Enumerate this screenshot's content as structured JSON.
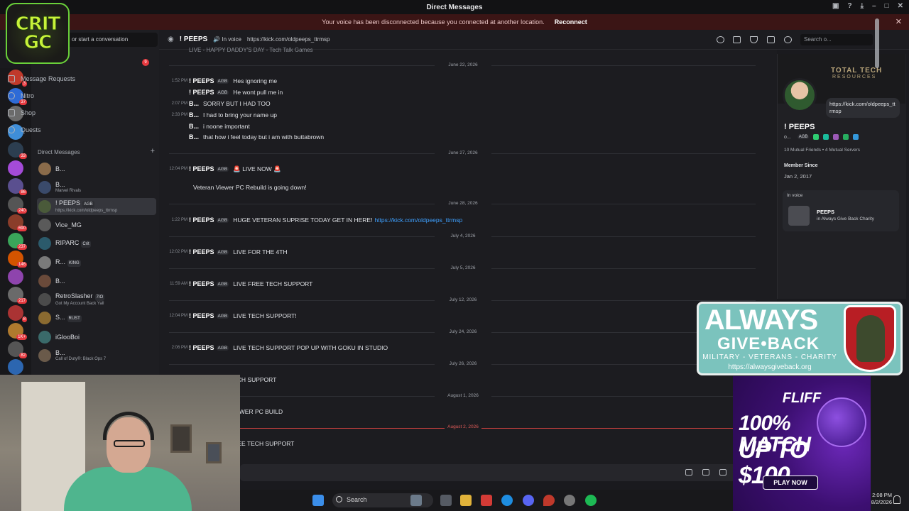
{
  "window": {
    "title": "Direct Messages"
  },
  "banner": {
    "message": "Your voice has been disconnected because you connected at another location.",
    "action": "Reconnect"
  },
  "overlay_logo": {
    "line1": "CRIT",
    "line2": "GC"
  },
  "top_search": {
    "placeholder": "or start a conversation"
  },
  "sidebar": {
    "nav": [
      {
        "label": "Message Requests"
      },
      {
        "label": "Nitro"
      },
      {
        "label": "Shop"
      },
      {
        "label": "Quests"
      }
    ],
    "dm_header": "Direct Messages",
    "dm_add": "+",
    "unread_badge": "9",
    "dms": [
      {
        "name": "B...",
        "sub": "",
        "tag": ""
      },
      {
        "name": "B...",
        "sub": "Marvel Rivals",
        "tag": ""
      },
      {
        "name": "! PEEPS",
        "sub": "https://kick.com/oldpeeps_ttrmsp",
        "tag": "AGB"
      },
      {
        "name": "Vice_MG",
        "sub": "",
        "tag": ""
      },
      {
        "name": "RIPARC",
        "sub": "",
        "tag": "Crit"
      },
      {
        "name": "R...",
        "sub": "",
        "tag": "KING"
      },
      {
        "name": "B...",
        "sub": "",
        "tag": ""
      },
      {
        "name": "RetroSlasher",
        "sub": "Got My Account Back Yall",
        "tag": "7IO"
      },
      {
        "name": "S...",
        "sub": "",
        "tag": "RUST"
      },
      {
        "name": "iGlooBoi",
        "sub": "",
        "tag": ""
      },
      {
        "name": "B...",
        "sub": "Call of Duty®: Black Ops 7",
        "tag": ""
      }
    ]
  },
  "server_badges": [
    "3",
    "37",
    "",
    "",
    "33",
    "",
    "86",
    "240",
    "690",
    "237",
    "146",
    "",
    "217",
    "8",
    "1K+",
    "82",
    ""
  ],
  "chat_header": {
    "title": "! PEEPS",
    "status": "In voice",
    "link": "https://kick.com/oldpeeps_ttrmsp",
    "search_placeholder": "Search o..."
  },
  "messages": {
    "top_clip": "LIVE - HAPPY DADDY'S DAY - Tech Talk Games",
    "groups": [
      {
        "date": "June 22, 2026",
        "items": [
          {
            "time": "1:52 PM",
            "author": "! PEEPS",
            "tag": "AGB",
            "text": "Hes ignoring me",
            "link": ""
          },
          {
            "time": "",
            "author": "! PEEPS",
            "tag": "AGB",
            "text": "He wont pull me in",
            "link": ""
          },
          {
            "time": "2:07 PM",
            "author": "B...",
            "tag": "",
            "text": "SORRY BUT I HAD TOO",
            "link": ""
          },
          {
            "time": "2:33 PM",
            "author": "B...",
            "tag": "",
            "text": "I had to bring your name up",
            "link": ""
          },
          {
            "time": "",
            "author": "B...",
            "tag": "",
            "text": "i noone important",
            "link": ""
          },
          {
            "time": "",
            "author": "B...",
            "tag": "",
            "text": "that how i feel today but i am with buttabrown",
            "link": ""
          }
        ]
      },
      {
        "date": "June 27, 2026",
        "items": [
          {
            "time": "12:04 PM",
            "author": "! PEEPS",
            "tag": "AGB",
            "text": "🚨 LIVE NOW 🚨",
            "link": ""
          },
          {
            "time": "",
            "author": "",
            "tag": "",
            "text": "Veteran Viewer PC Rebuild is going down!",
            "link": ""
          }
        ]
      },
      {
        "date": "June 28, 2026",
        "items": [
          {
            "time": "1:22 PM",
            "author": "! PEEPS",
            "tag": "AGB",
            "text": "HUGE VETERAN SUPRISE TODAY GET IN HERE!",
            "link": "https://kick.com/oldpeeps_ttrmsp"
          }
        ]
      },
      {
        "date": "July 4, 2026",
        "items": [
          {
            "time": "12:02 PM",
            "author": "! PEEPS",
            "tag": "AGB",
            "text": "LIVE FOR THE 4TH",
            "link": ""
          }
        ]
      },
      {
        "date": "July 5, 2026",
        "items": [
          {
            "time": "11:59 AM",
            "author": "! PEEPS",
            "tag": "AGB",
            "text": "LIVE FREE TECH SUPPORT",
            "link": ""
          }
        ]
      },
      {
        "date": "July 12, 2026",
        "items": [
          {
            "time": "12:04 PM",
            "author": "! PEEPS",
            "tag": "AGB",
            "text": "LIVE TECH SUPPORT!",
            "link": ""
          }
        ]
      },
      {
        "date": "July 24, 2026",
        "items": [
          {
            "time": "2:06 PM",
            "author": "! PEEPS",
            "tag": "AGB",
            "text": "LIVE TECH SUPPORT POP UP WITH GOKU IN STUDIO",
            "link": ""
          }
        ]
      },
      {
        "date": "July 26, 2026",
        "items": [
          {
            "time": "",
            "author": "",
            "tag": "",
            "text": "IVE TECH SUPPORT",
            "link": ""
          }
        ]
      },
      {
        "date": "August 1, 2026",
        "items": [
          {
            "time": "",
            "author": "",
            "tag": "",
            "text": "IVE VIEWER PC BUILD",
            "link": ""
          }
        ]
      },
      {
        "date": "August 2, 2026",
        "items": [
          {
            "time": "",
            "author": "",
            "tag": "",
            "text": "IVE FREE TECH SUPPORT",
            "link": ""
          }
        ]
      }
    ]
  },
  "profile": {
    "banner_brand": "TOTAL TECH",
    "banner_brand_sub": "RESOURCES",
    "bio": "https://kick.com/oldpeeps_ttrmsp",
    "name": "! PEEPS",
    "handle": "o...",
    "tag": "AGB",
    "mutual": "10 Mutual Friends  •  4 Mutual Servers",
    "member_since_label": "Member Since",
    "member_since": "Jan 2, 2017",
    "in_voice_label": "In voice",
    "voice_name": "PEEPS",
    "voice_channel": "in Always Give Back Charity"
  },
  "ad_agb": {
    "line1": "ALWAYS",
    "line2": "GIVE•BACK",
    "tagline": "MILITARY - VETERANS - CHARITY",
    "url": "https://alwaysgiveback.org"
  },
  "ad_fliff": {
    "brand": "FLIFF",
    "offer1": "100% MATCH",
    "offer2": "UP TO $100",
    "cta": "PLAY NOW"
  },
  "taskbar": {
    "search": "Search",
    "time": "2:08 PM",
    "date": "8/2/2026"
  },
  "colors": {
    "accent": "#5865f2",
    "link": "#3ea0ff",
    "danger": "#e6393f",
    "online": "#23a55a"
  }
}
